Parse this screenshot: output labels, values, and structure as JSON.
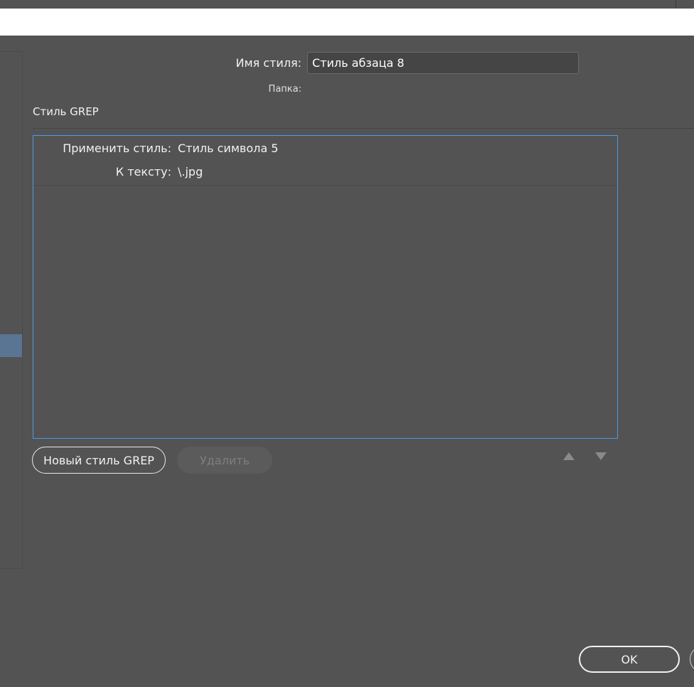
{
  "dialog": {
    "style_name_label": "Имя стиля:",
    "style_name_value": "Стиль абзаца 8",
    "folder_label": "Папка:"
  },
  "grep": {
    "section_title": "Стиль GREP",
    "items": [
      {
        "apply_style_label": "Применить стиль:",
        "apply_style_value": "Стиль символа 5",
        "to_text_label": "К тексту:",
        "to_text_value": "\\.jpg"
      }
    ],
    "new_button": "Новый стиль GREP",
    "delete_button": "Удалить"
  },
  "footer": {
    "ok_button": "OK"
  },
  "icons": {
    "move_up": "triangle-up-icon",
    "move_down": "triangle-down-icon"
  },
  "colors": {
    "background": "#535353",
    "selection_accent": "#4c9be8",
    "sidebar_selected": "#5a7594"
  }
}
